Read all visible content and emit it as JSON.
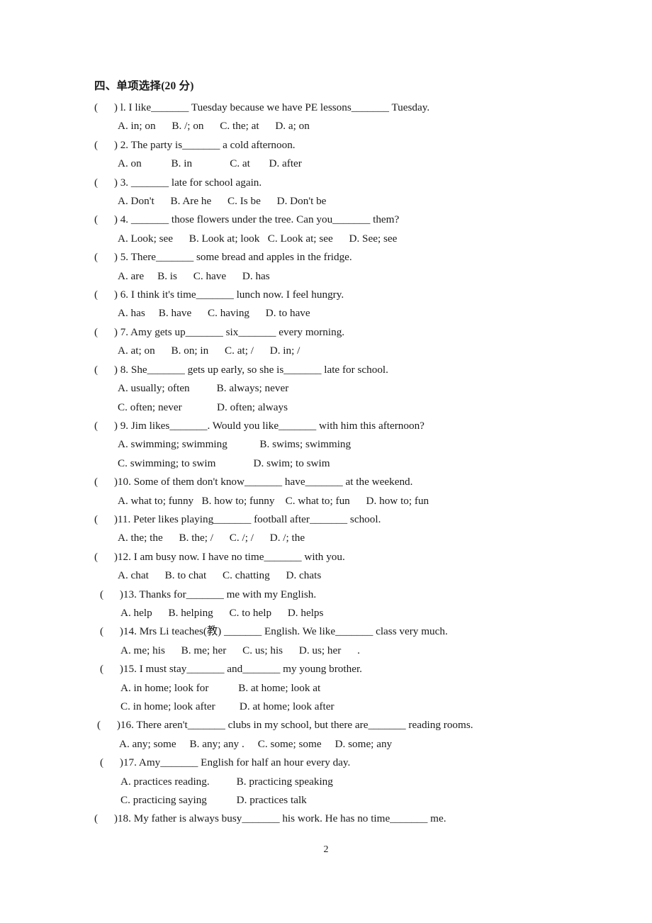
{
  "document": {
    "heading": "四、单项选择(20 分)",
    "page_number": "2"
  },
  "questions": [
    {
      "marker": "(      ) l.",
      "stem": " I like_______ Tuesday because we have PE lessons_______ Tuesday.",
      "option_lines": [
        "A. in; on      B. /; on      C. the; at      D. a; on"
      ],
      "indent": 0
    },
    {
      "marker": "(      ) 2.",
      "stem": " The party is_______ a cold afternoon.",
      "option_lines": [
        "A. on           B. in              C. at       D. after"
      ],
      "indent": 0
    },
    {
      "marker": "(      ) 3.",
      "stem": " _______ late for school again.",
      "option_lines": [
        "A. Don't      B. Are he      C. Is be      D. Don't be"
      ],
      "indent": 0
    },
    {
      "marker": "(      ) 4.",
      "stem": " _______ those flowers under the tree. Can you_______ them?",
      "option_lines": [
        "A. Look; see      B. Look at; look   C. Look at; see      D. See; see"
      ],
      "indent": 0
    },
    {
      "marker": "(      ) 5.",
      "stem": " There_______ some bread and apples in the fridge.",
      "option_lines": [
        "A. are     B. is      C. have      D. has"
      ],
      "indent": 0
    },
    {
      "marker": "(      ) 6.",
      "stem": " I think it's time_______ lunch now. I feel hungry.",
      "option_lines": [
        "A. has     B. have      C. having      D. to have"
      ],
      "indent": 0
    },
    {
      "marker": "(      ) 7.",
      "stem": " Amy gets up_______ six_______ every morning.",
      "option_lines": [
        "A. at; on      B. on; in      C. at; /      D. in; /"
      ],
      "indent": 0
    },
    {
      "marker": "(      ) 8.",
      "stem": " She_______ gets up early, so she is_______ late for school.",
      "option_lines": [
        "A. usually; often          B. always; never",
        "C. often; never             D. often; always"
      ],
      "indent": 0
    },
    {
      "marker": "(      ) 9.",
      "stem": " Jim likes_______. Would you like_______ with him this afternoon?",
      "option_lines": [
        "A. swimming; swimming            B. swims; swimming",
        "C. swimming; to swim              D. swim; to swim"
      ],
      "indent": 0
    },
    {
      "marker": "(      )10.",
      "stem": " Some of them don't know_______ have_______ at the weekend.",
      "option_lines": [
        "A. what to; funny   B. how to; funny    C. what to; fun      D. how to; fun"
      ],
      "indent": 0
    },
    {
      "marker": "(      )11.",
      "stem": " Peter likes playing_______ football after_______ school.",
      "option_lines": [
        "A. the; the      B. the; /      C. /; /      D. /; the"
      ],
      "indent": 0
    },
    {
      "marker": "(      )12.",
      "stem": " I am busy now. I have no time_______ with you.",
      "option_lines": [
        "A. chat      B. to chat      C. chatting      D. chats"
      ],
      "indent": 0
    },
    {
      "marker": "(      )13.",
      "stem": " Thanks for_______ me with my English.",
      "option_lines": [
        "A. help      B. helping      C. to help      D. helps"
      ],
      "indent": 1
    },
    {
      "marker": "(      )14.",
      "stem": " Mrs Li teaches(教) _______ English. We like_______ class very much.",
      "option_lines": [
        "A. me; his      B. me; her      C. us; his      D. us; her      ."
      ],
      "indent": 1
    },
    {
      "marker": "(      )15.",
      "stem": " I must stay_______ and_______ my young brother.",
      "option_lines": [
        "A. in home; look for           B. at home; look at",
        "C. in home; look after         D. at home; look after"
      ],
      "indent": 1
    },
    {
      "marker": "(      )16.",
      "stem": " There aren't_______ clubs in my school, but there are_______ reading rooms.",
      "option_lines": [
        "A. any; some     B. any; any .     C. some; some     D. some; any"
      ],
      "indent": 2
    },
    {
      "marker": "(      )17.",
      "stem": " Amy_______ English for half an hour every day.",
      "option_lines": [
        "A. practices reading.          B. practicing speaking",
        "C. practicing saying           D. practices talk"
      ],
      "indent": 1
    },
    {
      "marker": "(      )18.",
      "stem": " My father is always busy_______ his work. He has no time_______ me.",
      "option_lines": [],
      "indent": 0
    }
  ]
}
